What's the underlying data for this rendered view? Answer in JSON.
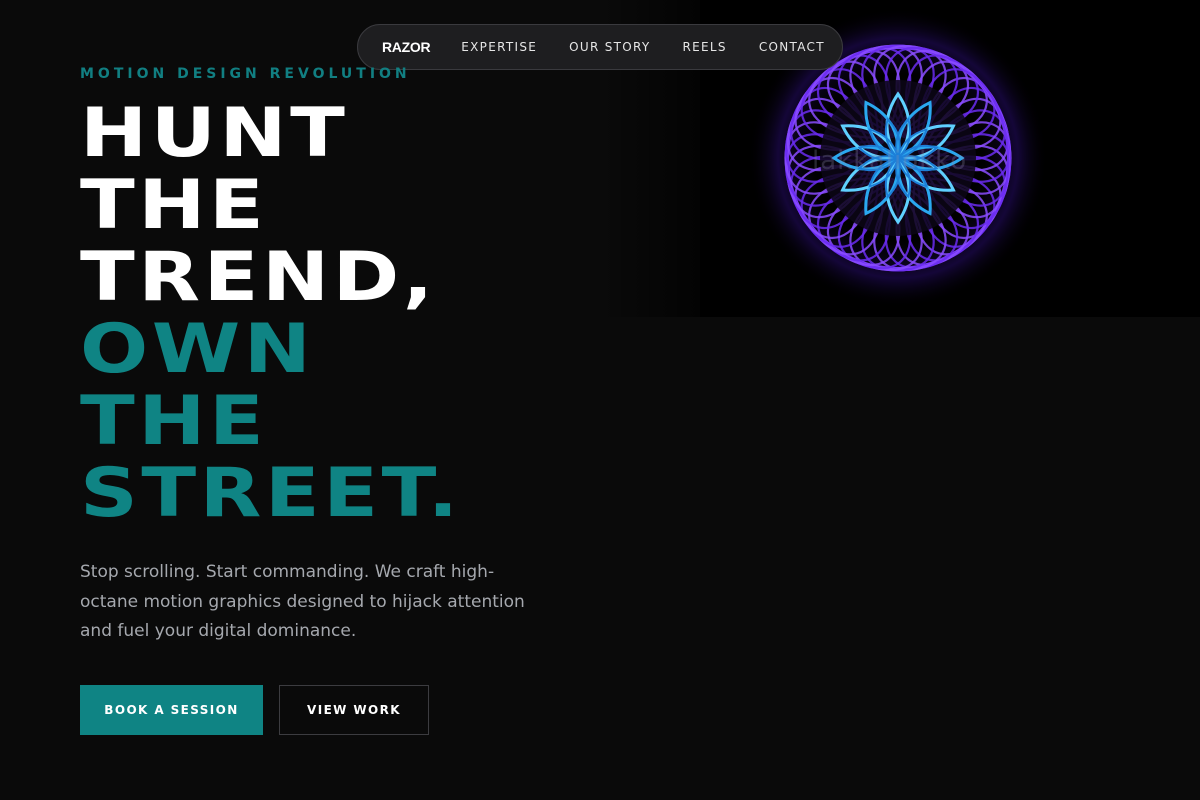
{
  "nav": {
    "logo": "RAZOR",
    "links": [
      "EXPERTISE",
      "OUR STORY",
      "REELS",
      "CONTACT"
    ]
  },
  "hero": {
    "eyebrow": "MOTION DESIGN REVOLUTION",
    "headline_white": [
      "HUNT",
      "THE",
      "TREND,"
    ],
    "headline_teal": [
      "OWN",
      "THE",
      "STREET."
    ],
    "lead": "Stop scrolling. Start commanding. We craft high-octane motion graphics designed to hijack attention and fuel your digital dominance.",
    "primary_button": "BOOK A SESSION",
    "secondary_button": "VIEW WORK"
  },
  "artwork": {
    "watermark": "lakkaliokko",
    "icon": "spiral-ring-flower-artwork"
  },
  "colors": {
    "background": "#0a0a0a",
    "accent_teal": "#0f8484",
    "text_muted": "#a5a8ae",
    "nav_background": "#1e1e20",
    "ring_purple": "#6a2cf0",
    "flower_blue": "#2aa8f0"
  }
}
